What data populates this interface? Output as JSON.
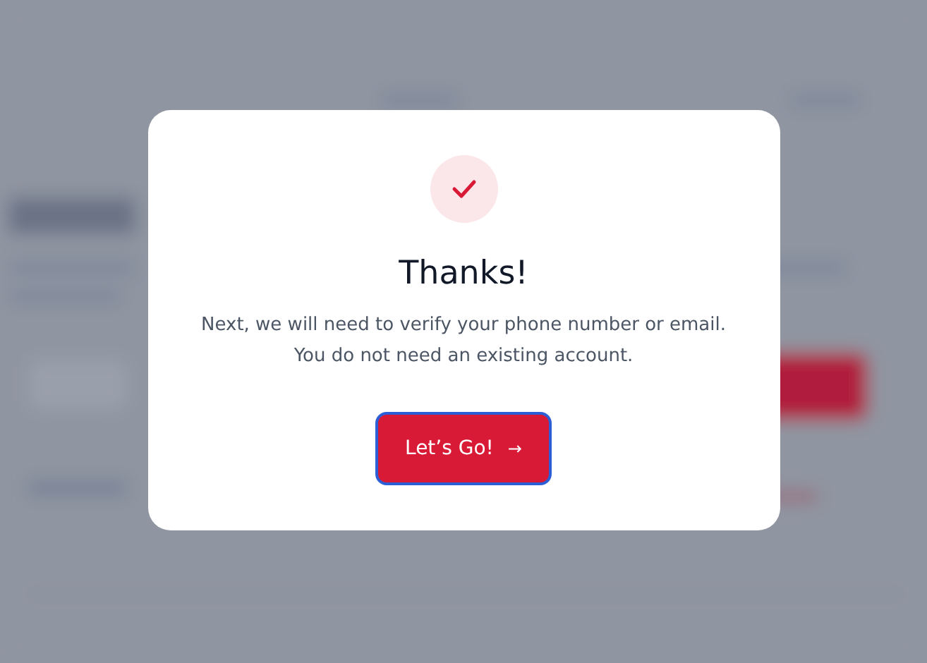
{
  "dialog": {
    "title": "Thanks!",
    "message": "Next, we will need to verify your phone number or email.\nYou do not need an existing account.",
    "button": {
      "label": "Let’s Go!",
      "icon": "→",
      "focused": true
    }
  }
}
